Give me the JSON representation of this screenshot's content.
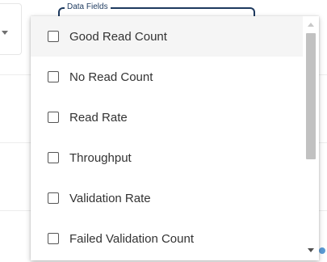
{
  "field": {
    "legend": "Data Fields"
  },
  "options": [
    {
      "label": "Good Read Count",
      "checked": false,
      "hovered": true
    },
    {
      "label": "No Read Count",
      "checked": false
    },
    {
      "label": "Read Rate",
      "checked": false
    },
    {
      "label": "Throughput",
      "checked": false
    },
    {
      "label": "Validation Rate",
      "checked": false
    },
    {
      "label": "Failed Validation Count",
      "checked": false
    }
  ],
  "colors": {
    "outline": "#1e3a5f",
    "hover_bg": "#f5f5f5",
    "text": "#333333",
    "scroll_thumb": "#c1c1c1",
    "accent_dot": "#5b9bd5"
  },
  "icons": {
    "scroll_up": "triangle-up-icon",
    "scroll_down": "triangle-down-icon",
    "select_caret": "caret-down-icon"
  }
}
